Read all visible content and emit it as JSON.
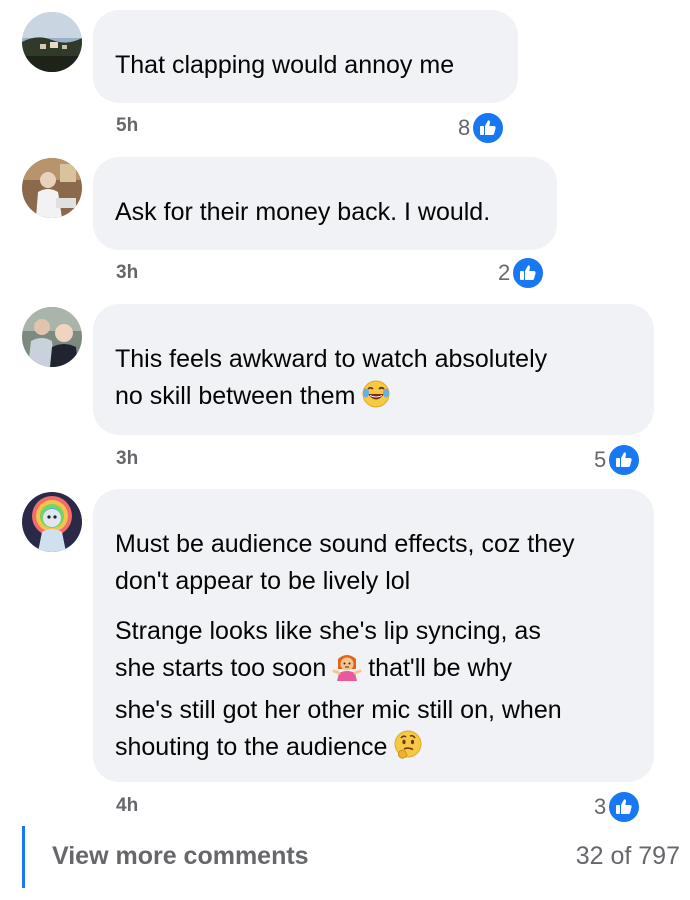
{
  "colors": {
    "bubble": "#f0f2f5",
    "text": "#050505",
    "secondary": "#65676b",
    "accent": "#1877f2"
  },
  "comments": [
    {
      "avatar": "avatar-coastal-town",
      "lines": [
        "That clapping would annoy me"
      ],
      "time": "5h",
      "likes": "8",
      "like_icon": "thumbs-up-icon"
    },
    {
      "avatar": "avatar-person-sitting",
      "lines": [
        "Ask for their money back. I would."
      ],
      "time": "3h",
      "likes": "2",
      "like_icon": "thumbs-up-icon"
    },
    {
      "avatar": "avatar-two-people",
      "lines": [
        "This feels awkward to watch absolutely",
        "no skill between them"
      ],
      "trailing_emoji": "face-with-tears-of-joy-emoji",
      "time": "3h",
      "likes": "5",
      "like_icon": "thumbs-up-icon"
    },
    {
      "avatar": "avatar-rainbow-character",
      "paragraph1": [
        "Must be audience sound effects, coz they",
        "don't appear to be lively lol"
      ],
      "paragraph2": {
        "line1": "Strange looks like she's lip syncing, as",
        "line2_before": "she starts too soon",
        "line2_emoji": "person-shrugging-emoji",
        "line2_after": "that'll be why",
        "line3": "she's still got her other mic still on, when",
        "line4": "shouting to the audience",
        "line4_emoji": "thinking-face-emoji"
      },
      "time": "4h",
      "likes": "3",
      "like_icon": "thumbs-up-icon"
    }
  ],
  "footer": {
    "view_more": "View more comments",
    "count": "32 of 797"
  }
}
